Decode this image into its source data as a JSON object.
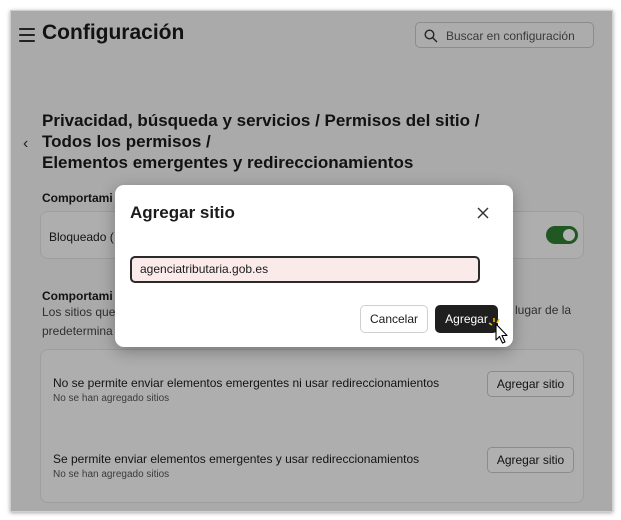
{
  "app": {
    "title": "Configuración"
  },
  "search": {
    "placeholder": "Buscar en configuración"
  },
  "breadcrumb": {
    "line1": "Privacidad, búsqueda y servicios / Permisos del sitio /",
    "line2": "Todos los permisos /",
    "line3": "Elementos emergentes y redireccionamientos"
  },
  "section1": {
    "heading": "Comportami",
    "row_label": "Bloqueado (",
    "toggle_on": true
  },
  "section2": {
    "heading": "Comportami",
    "desc_line1": "Los sitios que",
    "desc_line1_right": "lugar de la",
    "desc_line2": "predetermina"
  },
  "blocked_list": {
    "title": "No se permite enviar elementos emergentes ni usar redireccionamientos",
    "empty": "No se han agregado sitios",
    "add_label": "Agregar sitio"
  },
  "allowed_list": {
    "title": "Se permite enviar elementos emergentes y usar redireccionamientos",
    "empty": "No se han agregado sitios",
    "add_label": "Agregar sitio"
  },
  "dialog": {
    "title": "Agregar sitio",
    "input_value": "agenciatributaria.gob.es",
    "cancel_label": "Cancelar",
    "add_label": "Agregar"
  },
  "colors": {
    "accent": "#2f7d32",
    "primary_button": "#1f1f1f",
    "input_bg": "#faeaea"
  },
  "icons": {
    "menu": "hamburger-icon",
    "search": "search-icon",
    "back": "chevron-left-icon",
    "close": "close-icon",
    "cursor": "pointer-cursor-icon"
  }
}
